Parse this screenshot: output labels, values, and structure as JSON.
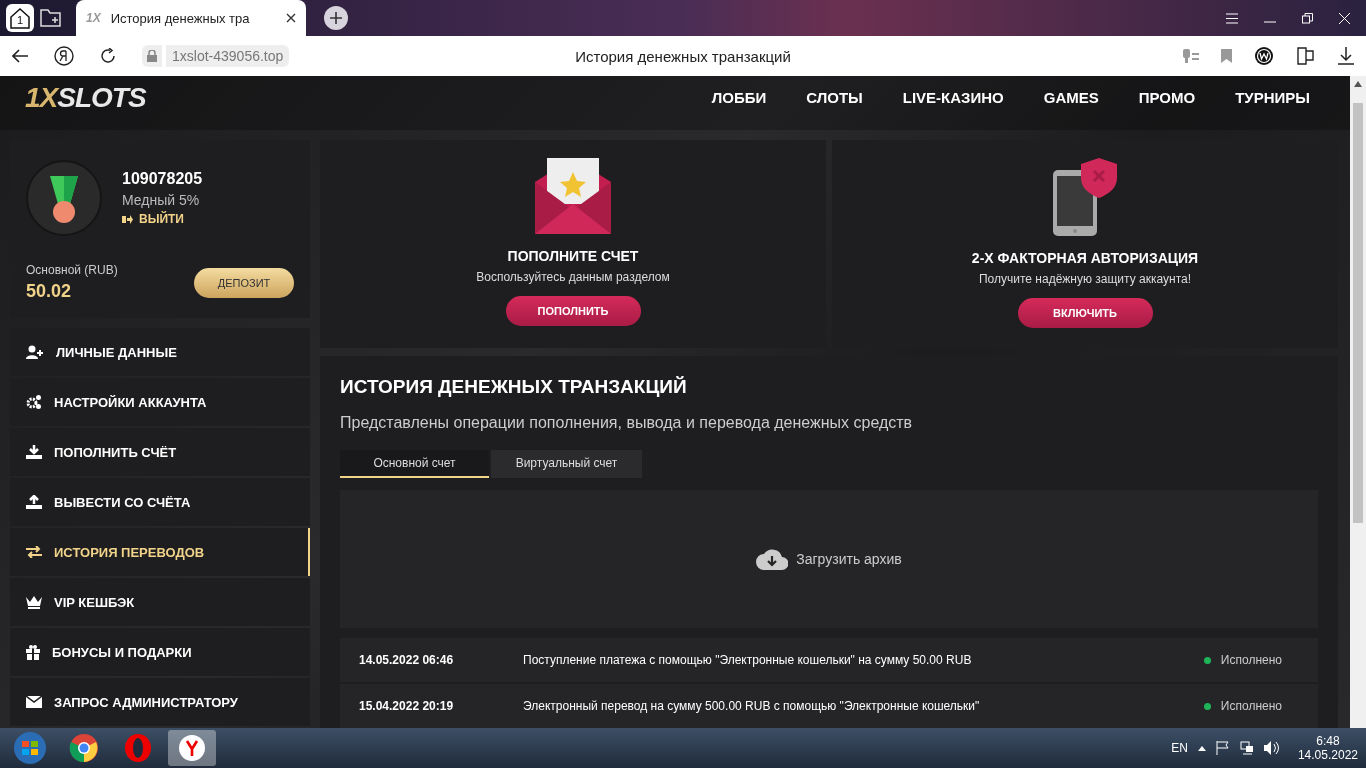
{
  "browser": {
    "tab_count": "1",
    "tab_icon": "1X",
    "tab_title": "История денежных тра",
    "url": "1xslot-439056.top",
    "page_title": "История денежных транзакций"
  },
  "header": {
    "logo_prefix": "1X",
    "logo_suffix": "SLOTS",
    "nav": [
      "ЛОББИ",
      "СЛОТЫ",
      "LIVE-КАЗИНО",
      "GAMES",
      "ПРОМО",
      "ТУРНИРЫ"
    ]
  },
  "profile": {
    "user_id": "109078205",
    "level": "Медный 5%",
    "logout": "ВЫЙТИ",
    "balance_label": "Основной (RUB)",
    "balance": "50.02",
    "deposit_button": "ДЕПОЗИТ"
  },
  "menu": [
    {
      "label": "ЛИЧНЫЕ ДАННЫЕ",
      "selected": false
    },
    {
      "label": "НАСТРОЙКИ АККАУНТА",
      "selected": false
    },
    {
      "label": "ПОПОЛНИТЬ СЧЁТ",
      "selected": false
    },
    {
      "label": "ВЫВЕСТИ СО СЧЁТА",
      "selected": false
    },
    {
      "label": "ИСТОРИЯ ПЕРЕВОДОВ",
      "selected": true
    },
    {
      "label": "VIP КЕШБЭК",
      "selected": false
    },
    {
      "label": "БОНУСЫ И ПОДАРКИ",
      "selected": false
    },
    {
      "label": "ЗАПРОС АДМИНИСТРАТОРУ",
      "selected": false
    }
  ],
  "promos": [
    {
      "kind": "deposit",
      "title": "ПОПОЛНИТЕ СЧЕТ",
      "text": "Воспользуйтесь данным разделом",
      "button": "ПОПОЛНИТЬ"
    },
    {
      "kind": "security",
      "title": "2-Х ФАКТОРНАЯ АВТОРИЗАЦИЯ",
      "text": "Получите надёжную защиту аккаунта!",
      "button": "ВКЛЮЧИТЬ"
    }
  ],
  "history": {
    "title": "ИСТОРИЯ ДЕНЕЖНЫХ ТРАНЗАКЦИЙ",
    "subtitle": "Представлены операции пополнения, вывода и перевода денежных средств",
    "tabs": [
      {
        "label": "Основной счет",
        "selected": true
      },
      {
        "label": "Виртуальный счет",
        "selected": false
      }
    ],
    "archive": "Загрузить архив",
    "rows": [
      {
        "date": "14.05.2022 06:46",
        "description": "Поступление платежа с помощью \"Электронные кошельки\" на сумму 50.00 RUB",
        "status": "Исполнено",
        "color": "#1fb45a"
      },
      {
        "date": "15.04.2022 20:19",
        "description": "Электронный перевод на сумму 500.00 RUB с помощью \"Электронные кошельки\"",
        "status": "Исполнено",
        "color": "#1fb45a"
      }
    ]
  },
  "taskbar": {
    "language": "EN",
    "time": "6:48",
    "date": "14.05.2022"
  }
}
